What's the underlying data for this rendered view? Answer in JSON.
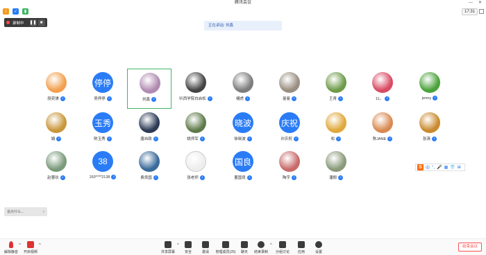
{
  "window": {
    "title": "腾讯会议",
    "minimize": "—",
    "close": "✕"
  },
  "status": {
    "clock": "17:31"
  },
  "recording": {
    "label": "录制中",
    "pause": "❚❚",
    "stop": "■"
  },
  "speaking_banner": "正在讲话: 刘鑫",
  "participants": [
    {
      "name": "段奕骐",
      "avatar": "",
      "color": "#f2a04e"
    },
    {
      "name": "吴停停",
      "avatar": "停停",
      "color": "#2a7cf6"
    },
    {
      "name": "刘鑫",
      "avatar": "",
      "color": "#b08ab0",
      "active": true
    },
    {
      "name": "叭西学院白启松",
      "avatar": "",
      "color": "#444444"
    },
    {
      "name": "樋虎",
      "avatar": "",
      "color": "#7d7d7d"
    },
    {
      "name": "曼曼",
      "avatar": "",
      "color": "#9a8e82"
    },
    {
      "name": "王青",
      "avatar": "",
      "color": "#6e9b4a"
    },
    {
      "name": "11。",
      "avatar": "",
      "color": "#d84b63"
    },
    {
      "name": "jenny",
      "avatar": "",
      "color": "#4aa33a"
    },
    {
      "name": "娟",
      "avatar": "",
      "color": "#c9973a"
    },
    {
      "name": "陈玉秀",
      "avatar": "玉秀",
      "color": "#2a7cf6"
    },
    {
      "name": "唐自政",
      "avatar": "",
      "color": "#2d3a56"
    },
    {
      "name": "姚师军",
      "avatar": "",
      "color": "#5e7a4a"
    },
    {
      "name": "徐晓波",
      "avatar": "晓波",
      "color": "#2a7cf6"
    },
    {
      "name": "许庆祝",
      "avatar": "庆祝",
      "color": "#2a7cf6"
    },
    {
      "name": "松",
      "avatar": "",
      "color": "#e0a83a"
    },
    {
      "name": "陈JANE",
      "avatar": "",
      "color": "#d98a52"
    },
    {
      "name": "张清",
      "avatar": "",
      "color": "#c98a2e"
    },
    {
      "name": "赵蓉玖",
      "avatar": "",
      "color": "#7a9a7a"
    },
    {
      "name": "150****2138",
      "avatar": "38",
      "color": "#2a7cf6"
    },
    {
      "name": "费良国",
      "avatar": "",
      "color": "#3a6a9a"
    },
    {
      "name": "张老师",
      "avatar": "",
      "color": "#eeeeee"
    },
    {
      "name": "董国良",
      "avatar": "国良",
      "color": "#2a7cf6"
    },
    {
      "name": "陶宇",
      "avatar": "",
      "color": "#c96a6a"
    },
    {
      "name": "潘樹",
      "avatar": "",
      "color": "#8a9a7a"
    }
  ],
  "chat": {
    "placeholder": "说点什么...",
    "send": "›"
  },
  "ime": {
    "logo": "S",
    "items": [
      "中",
      "°,",
      "🎤",
      "▦",
      "👕",
      "⊞"
    ]
  },
  "toolbar": {
    "mute": "解除静音",
    "video": "开启视频",
    "share": "共享屏幕",
    "security": "安全",
    "invite": "邀请",
    "members": "管理成员(25)",
    "chat": "聊天",
    "record": "结束录制",
    "breakout": "分组讨论",
    "apps": "应用",
    "settings": "设置",
    "end": "结束会议"
  }
}
